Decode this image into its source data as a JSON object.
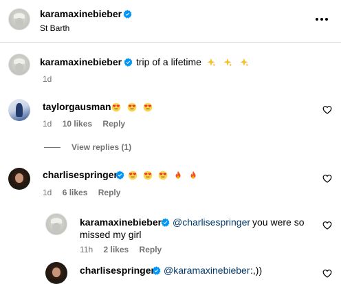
{
  "header": {
    "username": "karamaxinebieber",
    "location": "St Barth"
  },
  "caption": {
    "username": "karamaxinebieber",
    "text": "trip of a lifetime",
    "emojis": [
      "sparkles",
      "sparkles",
      "sparkles"
    ],
    "time": "1d"
  },
  "comments": [
    {
      "username": "taylorgausman",
      "emojis": [
        "heart-eyes",
        "heart-eyes",
        "heart-eyes"
      ],
      "time": "1d",
      "likes": "10 likes",
      "reply_label": "Reply",
      "view_replies": "View replies (1)"
    },
    {
      "username": "charlisespringer",
      "emojis": [
        "heart-eyes",
        "heart-eyes",
        "heart-eyes",
        "fire",
        "fire"
      ],
      "time": "1d",
      "likes": "6 likes",
      "reply_label": "Reply"
    }
  ],
  "replies": [
    {
      "username": "karamaxinebieber",
      "mention": "@charlisespringer",
      "text_line1": "you were so",
      "text_line2": "missed my girl",
      "time": "11h",
      "likes": "2 likes",
      "reply_label": "Reply"
    },
    {
      "username": "charlisespringer",
      "mention": "@karamaxinebieber",
      "text": ":,))"
    }
  ],
  "colors": {
    "verified": "#0095f6",
    "mention": "#00376b",
    "meta": "#737373",
    "divider": "#dbdbdb"
  }
}
